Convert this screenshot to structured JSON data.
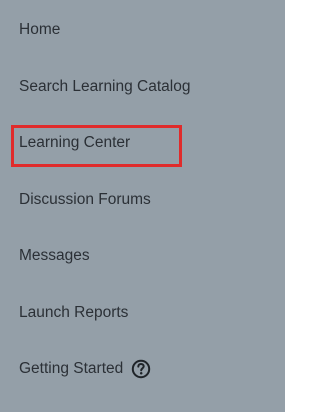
{
  "nav": {
    "items": [
      {
        "label": "Home"
      },
      {
        "label": "Search Learning Catalog"
      },
      {
        "label": "Learning Center"
      },
      {
        "label": "Discussion Forums"
      },
      {
        "label": "Messages"
      },
      {
        "label": "Launch Reports"
      },
      {
        "label": "Getting Started",
        "icon": "help-circle-icon"
      }
    ],
    "highlighted_item": "Learning Center"
  },
  "colors": {
    "panel_background": "#949fa8",
    "text": "#2b3036",
    "highlight_border": "#e02b2b"
  }
}
